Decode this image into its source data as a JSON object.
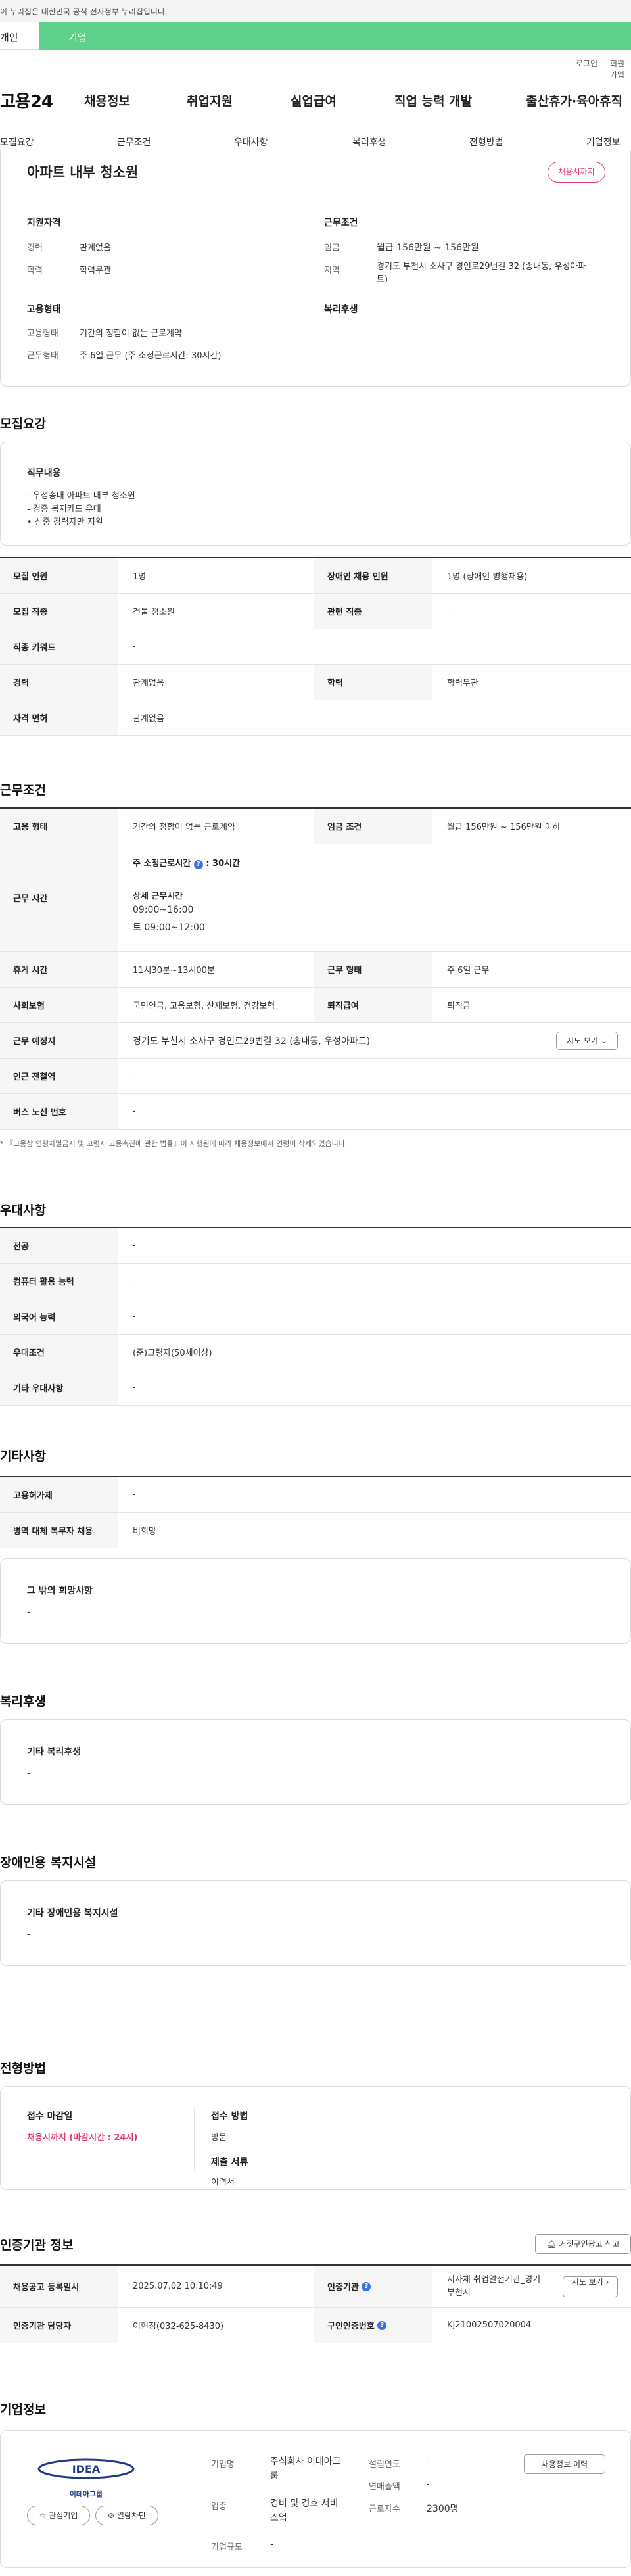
{
  "gov_notice": "이 누리집은 대한민국 공식 전자정부 누리집입니다.",
  "user_types": [
    "개인",
    "기업"
  ],
  "top_links": [
    "로그인",
    "회원가입"
  ],
  "logo": "고용24",
  "gnb": [
    "채용정보",
    "취업지원",
    "실업급여",
    "직업 능력 개발",
    "출산휴가·육아휴직"
  ],
  "lnb": [
    "모집요강",
    "근무조건",
    "우대사항",
    "복리후생",
    "전형방법",
    "기업정보"
  ],
  "job": {
    "title": "아파트 내부 청소원",
    "deadline_badge": "채용시까지",
    "qual_title": "지원자격",
    "career_k": "경력",
    "career_v": "관계없음",
    "edu_k": "학력",
    "edu_v": "학력무관",
    "cond_title": "근무조건",
    "wage_k": "임금",
    "wage_v": "월급 156만원 ~ 156만원",
    "region_k": "지역",
    "region_v": "경기도 부천시 소사구 경인로29번길 32 (송내동, 우성아파트)",
    "emp_title": "고용형태",
    "emp_type_k": "고용형태",
    "emp_type_v": "기간의 정함이 없는 근로계약",
    "work_form_k": "근무형태",
    "work_form_v": "주 6일 근무 (주 소정근로시간: 30시간)",
    "welfare_title": "복리후생"
  },
  "recruit": {
    "title": "모집요강",
    "duty_title": "직무내용",
    "duties": [
      "- 우성송내 아파트 내부 청소원",
      "- 경증 복지카드 우대",
      "• 신중 경력자만 지원"
    ],
    "rows": [
      [
        "모집 인원",
        "1명",
        "장애인 채용 인원",
        "1명 (장애인 병행채용)"
      ],
      [
        "모집 직종",
        "건물 청소원",
        "관련 직종",
        "-"
      ],
      [
        "직종 키워드",
        "-"
      ],
      [
        "경력",
        "관계없음",
        "학력",
        "학력무관"
      ],
      [
        "자격 면허",
        "관계없음"
      ]
    ]
  },
  "work": {
    "title": "근무조건",
    "emp_k": "고용 형태",
    "emp_v": "기간의 정함이 없는 근로계약",
    "wage_k": "임금 조건",
    "wage_v": "월급 156만원 ~ 156만원 이하",
    "time_k": "근무 시간",
    "weekly": "주 소정근로시간",
    "weekly_v": ": 30시간",
    "detail_title": "상세 근무시간",
    "detail": [
      "09:00~16:00",
      "토 09:00~12:00"
    ],
    "break_k": "휴게 시간",
    "break_v": "11시30분~13시00분",
    "form_k": "근무 형태",
    "form_v": "주 6일 근무",
    "ins_k": "사회보험",
    "ins_v": "국민연금, 고용보험, 산재보험, 건강보험",
    "sev_k": "퇴직급여",
    "sev_v": "퇴직금",
    "place_k": "근무 예정지",
    "place_v": "경기도 부천시 소사구 경인로29번길 32 (송내동, 우성아파트)",
    "map_btn": "지도 보기",
    "subway_k": "인근 전철역",
    "subway_v": "-",
    "bus_k": "버스 노선 번호",
    "bus_v": "-",
    "note": "* 『고용상 연령차별금지 및 고령자 고용촉진에 관한 법률』이 시행됨에 따라 채용정보에서 연령이 삭제되었습니다."
  },
  "pref": {
    "title": "우대사항",
    "rows": [
      [
        "전공",
        "-"
      ],
      [
        "컴퓨터 활용 능력",
        "-"
      ],
      [
        "외국어 능력",
        "-"
      ],
      [
        "우대조건",
        "(준)고령자(50세이상)"
      ],
      [
        "기타 우대사항",
        "-"
      ]
    ]
  },
  "etc": {
    "title": "기타사항",
    "rows": [
      [
        "고용허가제",
        "-"
      ],
      [
        "병역 대체 복무자 채용",
        "비희망"
      ]
    ],
    "hope_title": "그 밖의 희망사항",
    "hope_v": "-"
  },
  "welfare": {
    "title": "복리후생",
    "box_title": "기타 복리후생",
    "box_v": "-"
  },
  "disabled": {
    "title": "장애인용 복지시설",
    "box_title": "기타 장애인용 복지시설",
    "box_v": "-"
  },
  "process": {
    "title": "전형방법",
    "deadline_k": "접수 마감일",
    "deadline_v": "채용시까지 (마감시간 : 24시)",
    "method_k": "접수 방법",
    "method_v": "방문",
    "docs_k": "제출 서류",
    "docs_v": "이력서"
  },
  "cert": {
    "title": "인증기관 정보",
    "report_btn": "거짓구인광고 신고",
    "rows": [
      [
        "채용공고 등록일시",
        "2025.07.02 10:10:49",
        "인증기관",
        "지자체 취업알선기관_경기 부천시"
      ],
      [
        "인증기관 담당자",
        "이현정(032-625-8430)",
        "구인인증번호",
        "KJ21002507020004"
      ]
    ],
    "map_btn": "지도 보기"
  },
  "company": {
    "title": "기업정보",
    "logo_text": "이데아그룹",
    "fav_btn": "관심기업",
    "block_btn": "열람차단",
    "name_k": "기업명",
    "name_v": "주식회사 이데아그룹",
    "biz_k": "업종",
    "biz_v": "경비 및 경호 서비스업",
    "size_k": "기업규모",
    "size_v": "-",
    "year_k": "설립연도",
    "year_v": "-",
    "sales_k": "연매출액",
    "sales_v": "-",
    "emp_k": "근로자수",
    "emp_v": "2300명",
    "history_btn": "채용정보 이력"
  }
}
